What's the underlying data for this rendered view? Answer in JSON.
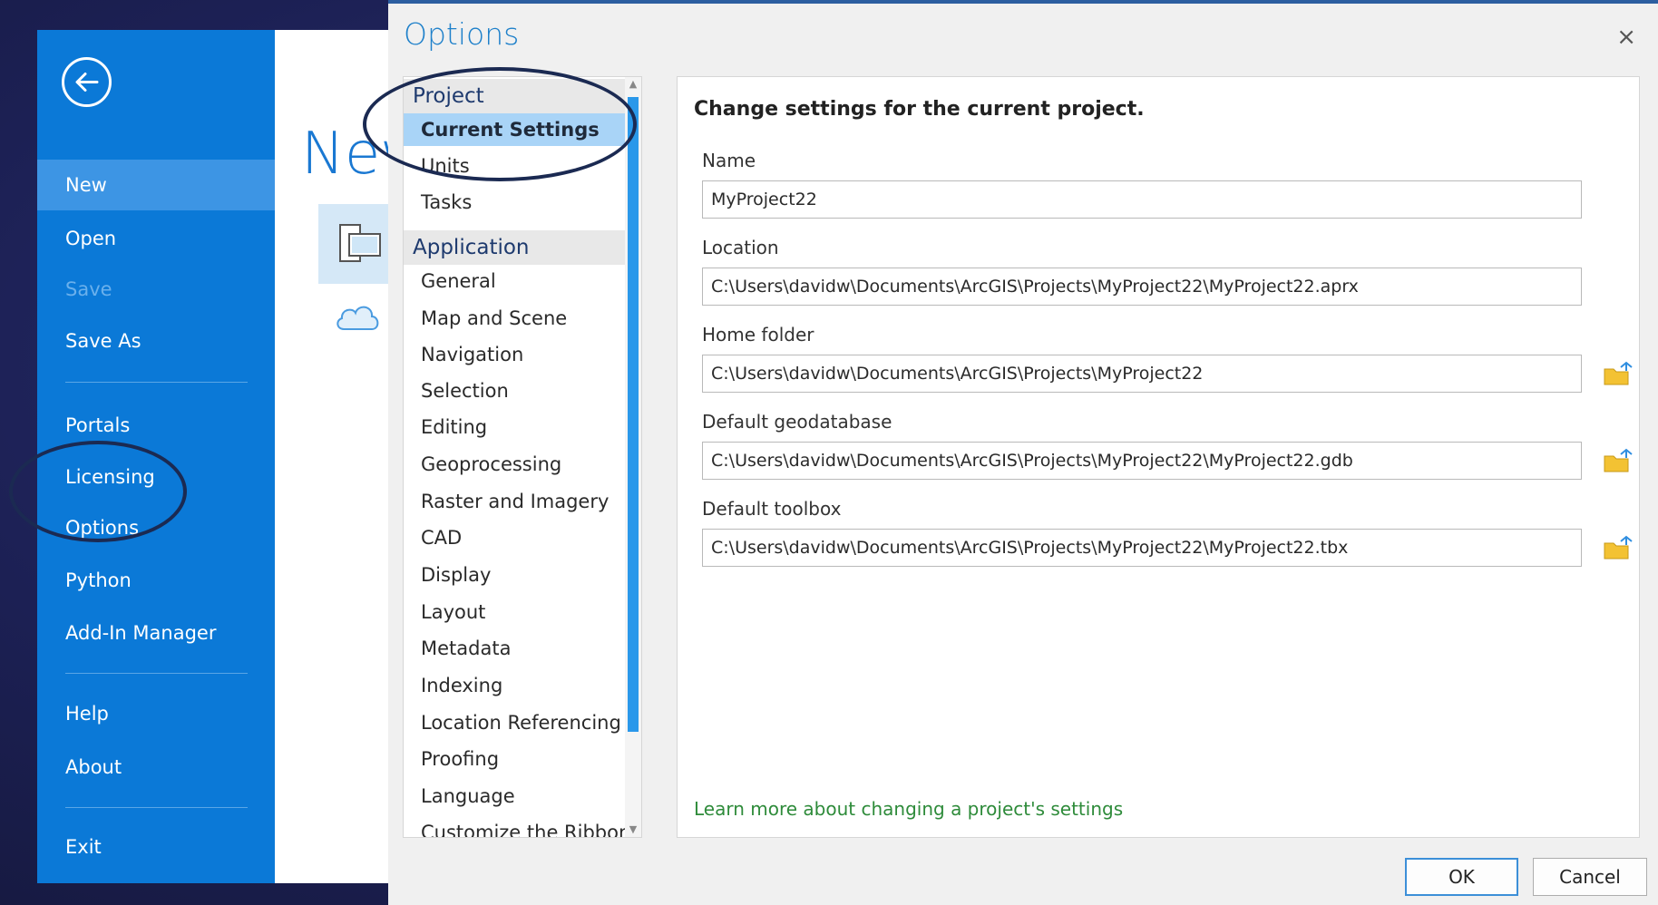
{
  "backstage": {
    "items": [
      {
        "label": "New",
        "state": "active"
      },
      {
        "label": "Open",
        "state": "normal"
      },
      {
        "label": "Save",
        "state": "disabled"
      },
      {
        "label": "Save As",
        "state": "normal"
      },
      {
        "label": "Portals",
        "state": "normal"
      },
      {
        "label": "Licensing",
        "state": "normal"
      },
      {
        "label": "Options",
        "state": "normal"
      },
      {
        "label": "Python",
        "state": "normal"
      },
      {
        "label": "Add-In Manager",
        "state": "normal"
      },
      {
        "label": "Help",
        "state": "normal"
      },
      {
        "label": "About",
        "state": "normal"
      },
      {
        "label": "Exit",
        "state": "normal"
      }
    ],
    "content_heading": "New",
    "colors": {
      "nav_bg": "#0b79d7",
      "active_bg": "#3d95e4"
    }
  },
  "dialog": {
    "title": "Options",
    "close_glyph": "×",
    "nav": {
      "project_header": "Project",
      "project_items": [
        "Current Settings",
        "Units",
        "Tasks"
      ],
      "application_header": "Application",
      "application_items": [
        "General",
        "Map and Scene",
        "Navigation",
        "Selection",
        "Editing",
        "Geoprocessing",
        "Raster and Imagery",
        "CAD",
        "Display",
        "Layout",
        "Metadata",
        "Indexing",
        "Location Referencing",
        "Proofing",
        "Language",
        "Customize the Ribbon"
      ],
      "selected": "Current Settings"
    },
    "panel": {
      "heading": "Change settings for the current project.",
      "fields": [
        {
          "label": "Name",
          "value": "MyProject22",
          "has_browse": false
        },
        {
          "label": "Location",
          "value": "C:\\Users\\davidw\\Documents\\ArcGIS\\Projects\\MyProject22\\MyProject22.aprx",
          "has_browse": false
        },
        {
          "label": "Home folder",
          "value": "C:\\Users\\davidw\\Documents\\ArcGIS\\Projects\\MyProject22",
          "has_browse": true
        },
        {
          "label": "Default geodatabase",
          "value": "C:\\Users\\davidw\\Documents\\ArcGIS\\Projects\\MyProject22\\MyProject22.gdb",
          "has_browse": true
        },
        {
          "label": "Default toolbox",
          "value": "C:\\Users\\davidw\\Documents\\ArcGIS\\Projects\\MyProject22\\MyProject22.tbx",
          "has_browse": true
        }
      ],
      "link": "Learn more about changing a project's settings"
    },
    "buttons": {
      "ok": "OK",
      "cancel": "Cancel"
    },
    "colors": {
      "title": "#1e80ca",
      "selected_item": "#a9d4f7",
      "link": "#2e8b3a"
    }
  }
}
